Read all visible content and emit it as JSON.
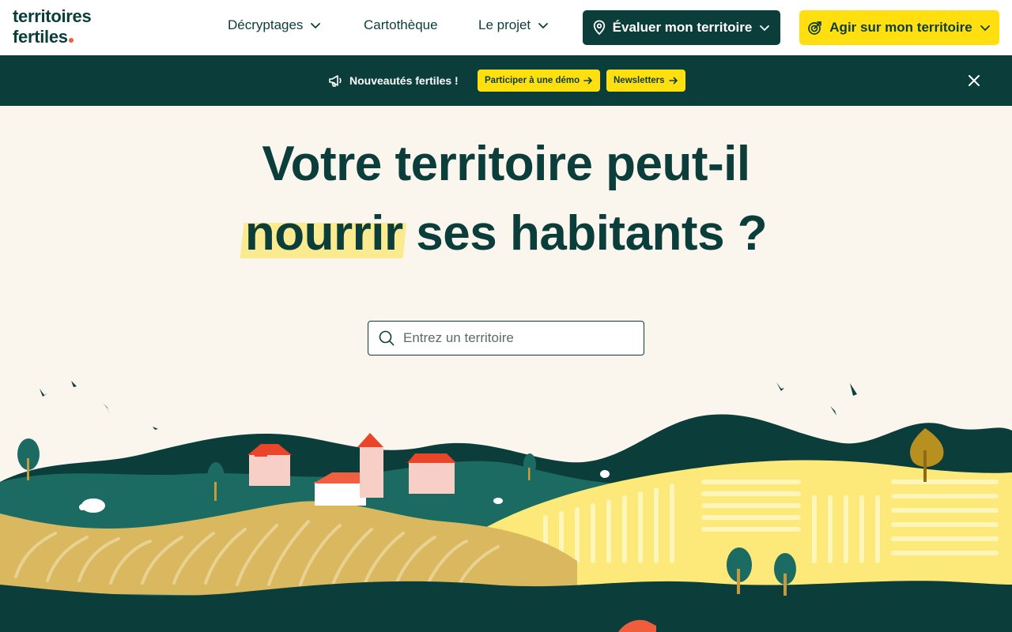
{
  "header": {
    "logo_line1": "territoires",
    "logo_line2": "fertiles",
    "nav": [
      {
        "label": "Décryptages",
        "icon": "chevron-down-icon"
      },
      {
        "label": "Cartothèque"
      },
      {
        "label": "Le projet",
        "icon": "chevron-down-icon"
      }
    ],
    "evaluate_button": "Évaluer mon territoire",
    "act_button": "Agir sur mon territoire"
  },
  "banner": {
    "title": "Nouveautés fertiles !",
    "demo_pill": "Participer à une démo",
    "newsletter_pill": "Newsletters"
  },
  "hero": {
    "line1": "Votre territoire peut-il",
    "highlight": "nourrir",
    "line2_rest": " ses habitants ?",
    "search_placeholder": "Entrez un territoire"
  },
  "colors": {
    "primary": "#0b3d3a",
    "accent": "#ffdf0f",
    "background": "#faf6ee",
    "highlight": "#fbeb90"
  }
}
